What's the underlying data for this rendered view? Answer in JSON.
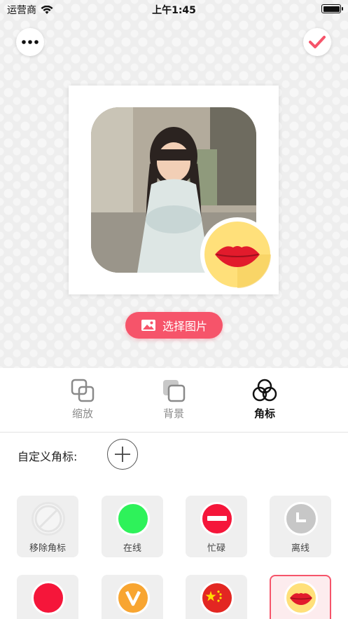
{
  "status": {
    "carrier": "运营商",
    "time": "上午1:45"
  },
  "actions": {
    "pick_image_label": "选择图片"
  },
  "tabs": [
    {
      "label": "缩放",
      "active": false
    },
    {
      "label": "背景",
      "active": false
    },
    {
      "label": "角标",
      "active": true
    }
  ],
  "custom": {
    "label": "自定义角标:"
  },
  "badges": [
    {
      "label": "移除角标",
      "icon": "no-badge-icon",
      "color": "#ffffff"
    },
    {
      "label": "在线",
      "icon": "green-dot-icon",
      "color": "#2ef25a"
    },
    {
      "label": "忙碌",
      "icon": "busy-icon",
      "color": "#f5163a"
    },
    {
      "label": "离线",
      "icon": "clock-icon",
      "color": "#c7c7c7"
    },
    {
      "label": "",
      "icon": "red-dot-icon",
      "color": "#f5163a"
    },
    {
      "label": "",
      "icon": "v-icon",
      "color": "#f8a531"
    },
    {
      "label": "",
      "icon": "china-flag-icon",
      "color": "#e32722"
    },
    {
      "label": "",
      "icon": "lips-icon",
      "color": "#ffe07a",
      "selected": true
    }
  ],
  "colors": {
    "accent": "#f6546a"
  }
}
